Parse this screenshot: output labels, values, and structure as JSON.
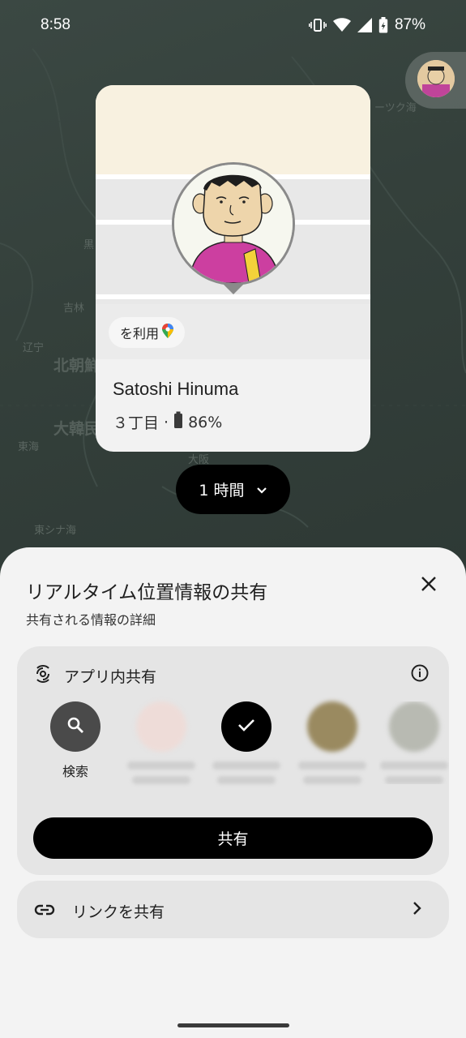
{
  "status_bar": {
    "time": "8:58",
    "battery": "87%"
  },
  "map": {
    "labels": [
      "北朝鮮",
      "大韓民",
      "吉林",
      "辽宁",
      "黒",
      "東海",
      "東シナ海",
      "大阪",
      "ーツク海"
    ]
  },
  "card": {
    "google_maps_chip": "を利用",
    "name": "Satoshi Hinuma",
    "address": "３丁目",
    "separator": "·",
    "battery": "86%"
  },
  "duration": {
    "label": "1 時間"
  },
  "sheet": {
    "title": "リアルタイム位置情報の共有",
    "subtitle": "共有される情報の詳細",
    "in_app": {
      "title": "アプリ内共有",
      "search_label": "検索",
      "share_button": "共有"
    },
    "link_row": {
      "label": "リンクを共有"
    }
  },
  "colors": {
    "accent": "#000000",
    "sheet_bg": "#f3f3f3",
    "panel_bg": "#e5e5e5",
    "map_bg": "#34403b"
  }
}
